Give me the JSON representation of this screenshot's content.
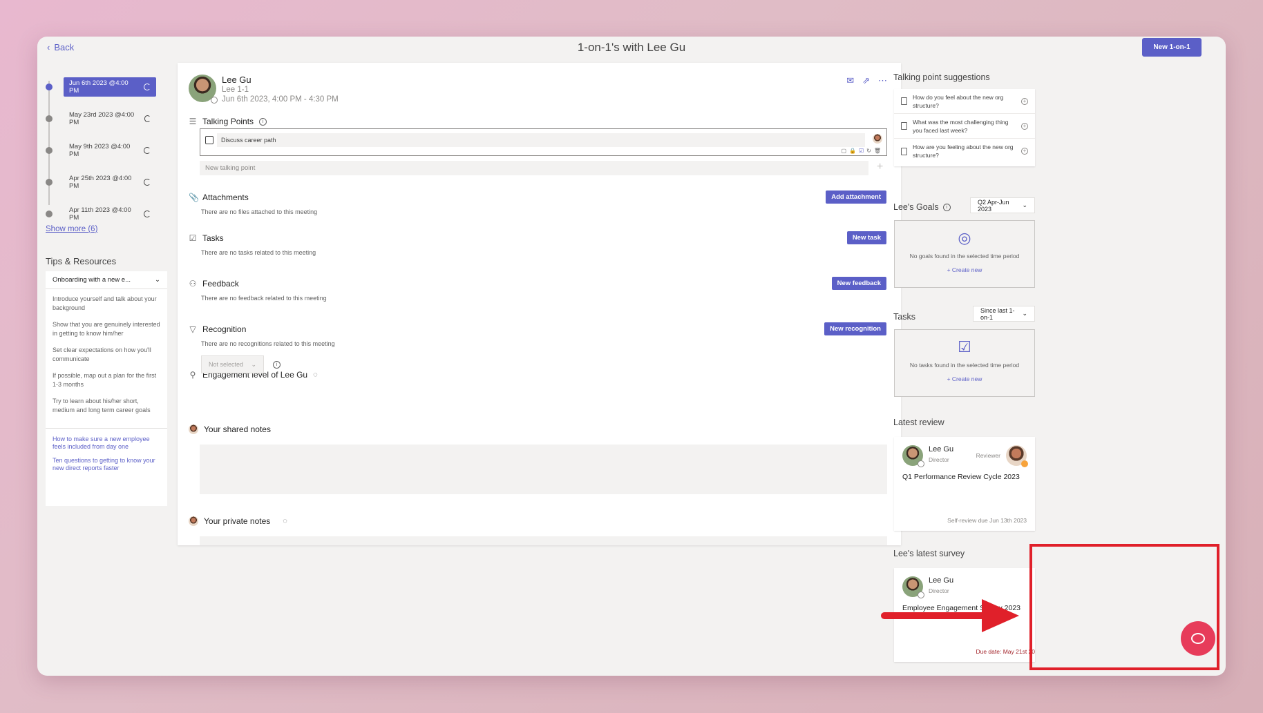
{
  "header": {
    "back": "Back",
    "title": "1-on-1's with Lee Gu",
    "new_button": "New 1-on-1"
  },
  "timeline": {
    "items": [
      {
        "label": "Jun 6th 2023 @4:00 PM"
      },
      {
        "label": "May 23rd 2023 @4:00 PM"
      },
      {
        "label": "May 9th 2023 @4:00 PM"
      },
      {
        "label": "Apr 25th 2023 @4:00 PM"
      },
      {
        "label": "Apr 11th 2023 @4:00 PM"
      }
    ],
    "show_more": "Show more (6)"
  },
  "tips": {
    "title": "Tips & Resources",
    "select": "Onboarding with a new e...",
    "items": [
      "Introduce yourself and talk about your background",
      "Show that you are genuinely interested in getting to know him/her",
      "Set clear expectations on how you'll communicate",
      "If possible, map out a plan for the first 1-3 months",
      "Try to learn about his/her short, medium and long term career goals"
    ],
    "links": [
      "How to make sure a new employee feels included from day one",
      "Ten questions to getting to know your new direct reports faster"
    ]
  },
  "meeting": {
    "name": "Lee Gu",
    "subtitle": "Lee 1-1",
    "time": "Jun 6th 2023, 4:00 PM - 4:30 PM",
    "talking_points": {
      "title": "Talking Points",
      "item": "Discuss career path",
      "placeholder": "New talking point"
    },
    "attachments": {
      "title": "Attachments",
      "empty": "There are no files attached to this meeting",
      "button": "Add attachment"
    },
    "tasks": {
      "title": "Tasks",
      "empty": "There are no tasks related to this meeting",
      "button": "New task"
    },
    "feedback": {
      "title": "Feedback",
      "empty": "There are no feedback related to this meeting",
      "button": "New feedback"
    },
    "recognition": {
      "title": "Recognition",
      "empty": "There are no recognitions related to this meeting",
      "button": "New recognition"
    },
    "engagement": {
      "title": "Engagement level of Lee Gu",
      "select": "Not selected"
    },
    "shared_notes": "Your shared notes",
    "private_notes": "Your private notes"
  },
  "suggestions": {
    "title": "Talking point suggestions",
    "items": [
      "How do you feel about the new org structure?",
      "What was the most challenging thing you faced last week?",
      "How are you feeling about the new org structure?"
    ]
  },
  "goals": {
    "title": "Lee's Goals",
    "period": "Q2 Apr-Jun 2023",
    "empty": "No goals found in the selected time period",
    "create": "+ Create new"
  },
  "tasks_panel": {
    "title": "Tasks",
    "period": "Since last 1-on-1",
    "empty": "No tasks found in the selected time period",
    "create": "+ Create new"
  },
  "latest_review": {
    "title": "Latest review",
    "name": "Lee Gu",
    "role": "Director",
    "reviewer": "Reviewer",
    "review_title": "Q1 Performance Review Cycle 2023",
    "due": "Self-review due Jun 13th 2023"
  },
  "latest_survey": {
    "title": "Lee's latest survey",
    "name": "Lee Gu",
    "role": "Director",
    "survey_title": "Employee Engagement Survey 2023",
    "due": "Due date: May 21st 20"
  },
  "colors": {
    "accent": "#5b5fc7",
    "highlight": "#e0202a"
  }
}
